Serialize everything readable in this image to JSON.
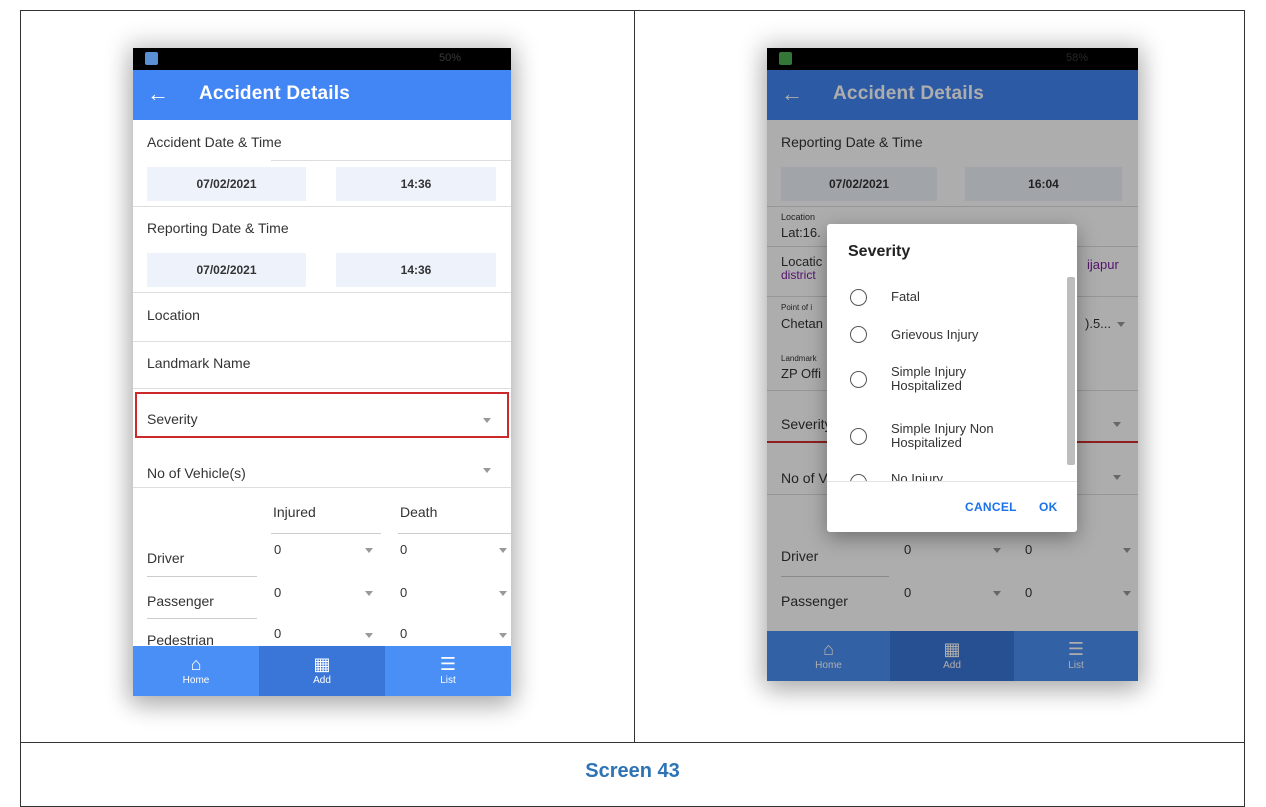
{
  "left_screen": {
    "status": "50%",
    "app_title": "Accident Details",
    "accident_label": "Accident Date & Time",
    "accident_date": "07/02/2021",
    "accident_time": "14:36",
    "reporting_label": "Reporting Date & Time",
    "reporting_date": "07/02/2021",
    "reporting_time": "14:36",
    "location_label": "Location",
    "landmark_label": "Landmark Name",
    "severity_label": "Severity",
    "vehicles_label": "No of Vehicle(s)",
    "col_injured": "Injured",
    "col_death": "Death",
    "rows": [
      {
        "label": "Driver",
        "injured": "0",
        "death": "0"
      },
      {
        "label": "Passenger",
        "injured": "0",
        "death": "0"
      },
      {
        "label": "Pedestrian",
        "injured": "0",
        "death": "0"
      }
    ],
    "nav": [
      {
        "label": "Home",
        "icon": "home-icon"
      },
      {
        "label": "Add",
        "icon": "grid-icon"
      },
      {
        "label": "List",
        "icon": "list-icon"
      }
    ]
  },
  "right_screen": {
    "status": "58%",
    "app_title": "Accident Details",
    "reporting_label": "Reporting Date & Time",
    "reporting_date": "07/02/2021",
    "reporting_time": "16:04",
    "location_small": "Location",
    "location_value": "Lat:16.",
    "location2_label": "Locatic",
    "location2_sub": "district",
    "location2_right": "ijapur",
    "poi_small": "Point of i",
    "poi_value": "Chetan",
    "poi_right": ").5...",
    "landmark_small": "Landmark",
    "landmark_value": "ZP Offi",
    "severity_label": "Severity",
    "vehicles_label": "No of V",
    "rows": [
      {
        "label": "Driver",
        "injured": "0",
        "death": "0"
      },
      {
        "label": "Passenger",
        "injured": "0",
        "death": "0"
      }
    ],
    "dialog": {
      "title": "Severity",
      "options": [
        "Fatal",
        "Grievous Injury",
        "Simple Injury\nHospitalized",
        "Simple Injury Non\nHospitalized",
        "No Injury"
      ],
      "cancel": "CANCEL",
      "ok": "OK"
    },
    "nav": [
      {
        "label": "Home",
        "icon": "home-icon"
      },
      {
        "label": "Add",
        "icon": "grid-icon"
      },
      {
        "label": "List",
        "icon": "list-icon"
      }
    ]
  },
  "caption": "Screen 43",
  "colors": {
    "appbar": "#4285f4",
    "highlight": "#cc2a2a",
    "caption": "#2e74b5",
    "dialog_button": "#1a73e8"
  }
}
